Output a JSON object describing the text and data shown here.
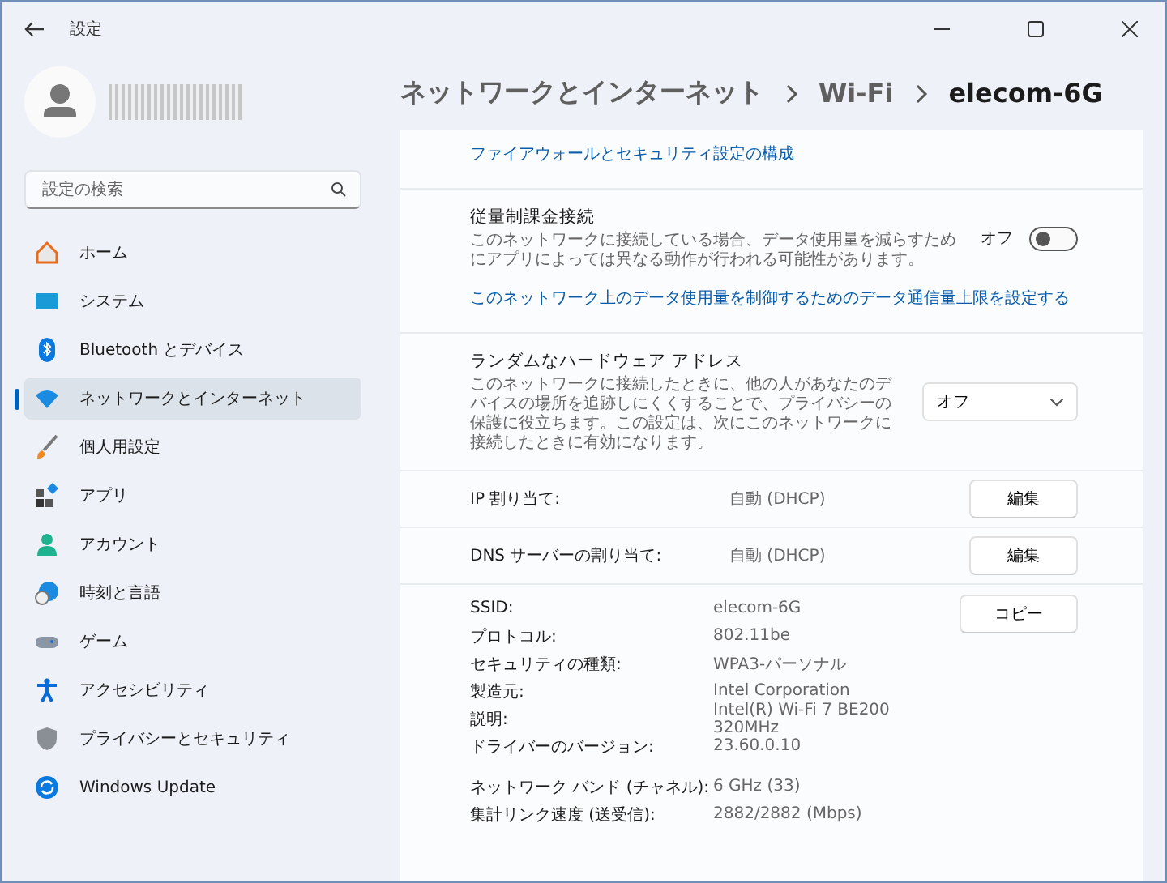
{
  "window": {
    "title": "設定"
  },
  "sidebar": {
    "search": {
      "placeholder": "設定の検索"
    },
    "items": [
      {
        "kind": "home",
        "label": "ホーム",
        "selected": false
      },
      {
        "kind": "system",
        "label": "システム",
        "selected": false
      },
      {
        "kind": "bluetooth",
        "label": "Bluetooth とデバイス",
        "selected": false
      },
      {
        "kind": "network",
        "label": "ネットワークとインターネット",
        "selected": true
      },
      {
        "kind": "personalize",
        "label": "個人用設定",
        "selected": false
      },
      {
        "kind": "apps",
        "label": "アプリ",
        "selected": false
      },
      {
        "kind": "account",
        "label": "アカウント",
        "selected": false
      },
      {
        "kind": "time",
        "label": "時刻と言語",
        "selected": false
      },
      {
        "kind": "game",
        "label": "ゲーム",
        "selected": false
      },
      {
        "kind": "accessibility",
        "label": "アクセシビリティ",
        "selected": false
      },
      {
        "kind": "privacy",
        "label": "プライバシーとセキュリティ",
        "selected": false
      },
      {
        "kind": "update",
        "label": "Windows Update",
        "selected": false
      }
    ]
  },
  "breadcrumb": [
    "ネットワークとインターネット",
    "Wi-Fi",
    "elecom-6G"
  ],
  "firewall_link": "ファイアウォールとセキュリティ設定の構成",
  "metered": {
    "title": "従量制課金接続",
    "description": "このネットワークに接続している場合、データ使用量を減らすためにアプリによっては異なる動作が行われる可能性があります。",
    "state_label": "オフ",
    "on": false,
    "link": "このネットワーク上のデータ使用量を制御するためのデータ通信量上限を設定する"
  },
  "random_mac": {
    "title": "ランダムなハードウェア アドレス",
    "description": "このネットワークに接続したときに、他の人があなたのデバイスの場所を追跡しにくくすることで、プライバシーの保護に役立ちます。この設定は、次にこのネットワークに接続したときに有効になります。",
    "value": "オフ"
  },
  "assignments": [
    {
      "label": "IP 割り当て:",
      "value": "自動 (DHCP)",
      "button": "編集"
    },
    {
      "label": "DNS サーバーの割り当て:",
      "value": "自動 (DHCP)",
      "button": "編集"
    }
  ],
  "properties": {
    "copy_button": "コピー",
    "groups": [
      [
        {
          "label": "SSID:",
          "value": "elecom-6G"
        },
        {
          "label": "プロトコル:",
          "value": "802.11be"
        },
        {
          "label": "セキュリティの種類:",
          "value": "WPA3-パーソナル"
        },
        {
          "label": "製造元:",
          "value": "Intel Corporation"
        },
        {
          "label": "説明:",
          "value": "Intel(R) Wi-Fi 7 BE200 320MHz"
        },
        {
          "label": "ドライバーのバージョン:",
          "value": "23.60.0.10"
        }
      ],
      [
        {
          "label": "ネットワーク バンド (チャネル):",
          "value": "6 GHz (33)"
        },
        {
          "label": "集計リンク速度 (送受信):",
          "value": "2882/2882 (Mbps)"
        }
      ]
    ]
  }
}
